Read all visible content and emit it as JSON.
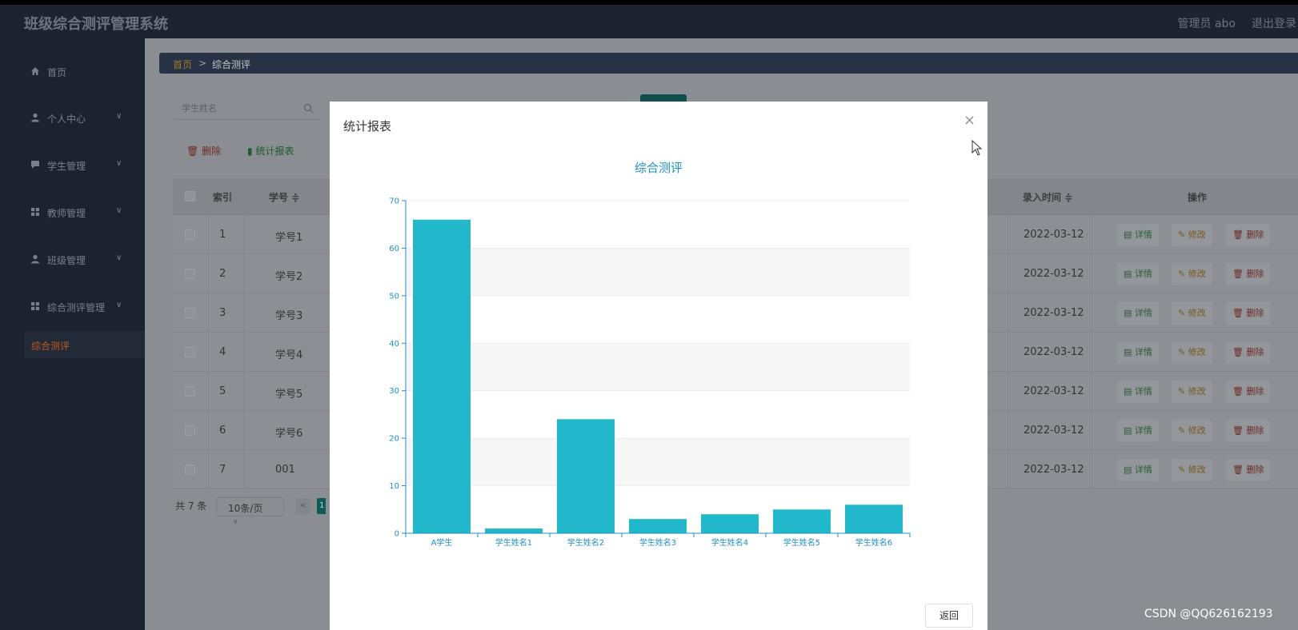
{
  "header": {
    "title": "班级综合测评管理系统",
    "admin": "管理员 abo",
    "logout": "退出登录"
  },
  "sidebar": {
    "items": [
      {
        "label": "首页",
        "icon": "home-icon",
        "chevron": false
      },
      {
        "label": "个人中心",
        "icon": "user-icon",
        "chevron": true
      },
      {
        "label": "学生管理",
        "icon": "chat-icon",
        "chevron": true
      },
      {
        "label": "教师管理",
        "icon": "grid-icon",
        "chevron": true
      },
      {
        "label": "班级管理",
        "icon": "user-icon",
        "chevron": true
      },
      {
        "label": "综合测评管理",
        "icon": "grid-icon",
        "chevron": true
      }
    ],
    "active_sub": "综合测评"
  },
  "breadcrumb": {
    "home": "首页",
    "sep": ">",
    "current": "综合测评"
  },
  "search": {
    "placeholder": "学生姓名"
  },
  "toolbar": {
    "delete": "删除",
    "stats": "统计报表"
  },
  "table": {
    "headers": {
      "index": "索引",
      "number": "学号 ≑",
      "time": "录入时间 ≑",
      "ops": "操作"
    },
    "rows": [
      {
        "idx": "1",
        "num": "学号1",
        "date": "2022-03-12"
      },
      {
        "idx": "2",
        "num": "学号2",
        "date": "2022-03-12"
      },
      {
        "idx": "3",
        "num": "学号3",
        "date": "2022-03-12"
      },
      {
        "idx": "4",
        "num": "学号4",
        "date": "2022-03-12"
      },
      {
        "idx": "5",
        "num": "学号5",
        "date": "2022-03-12"
      },
      {
        "idx": "6",
        "num": "学号6",
        "date": "2022-03-12"
      },
      {
        "idx": "7",
        "num": "001",
        "date": "2022-03-12"
      }
    ],
    "ops": {
      "detail": "详情",
      "edit": "修改",
      "delete": "删除"
    }
  },
  "pager": {
    "total": "共 7 条",
    "size": "10条/页",
    "page": "1"
  },
  "modal": {
    "title": "统计报表",
    "back": "返回"
  },
  "chart_data": {
    "type": "bar",
    "title": "综合测评",
    "categories": [
      "A学生",
      "学生姓名1",
      "学生姓名2",
      "学生姓名3",
      "学生姓名4",
      "学生姓名5",
      "学生姓名6"
    ],
    "values": [
      66,
      1,
      24,
      3,
      4,
      5,
      6
    ],
    "ylim": [
      0,
      70
    ],
    "yticks": [
      0,
      10,
      20,
      30,
      40,
      50,
      60,
      70
    ],
    "grid": true,
    "color": "#22b8cc"
  },
  "watermark": "CSDN @QQ626162193"
}
